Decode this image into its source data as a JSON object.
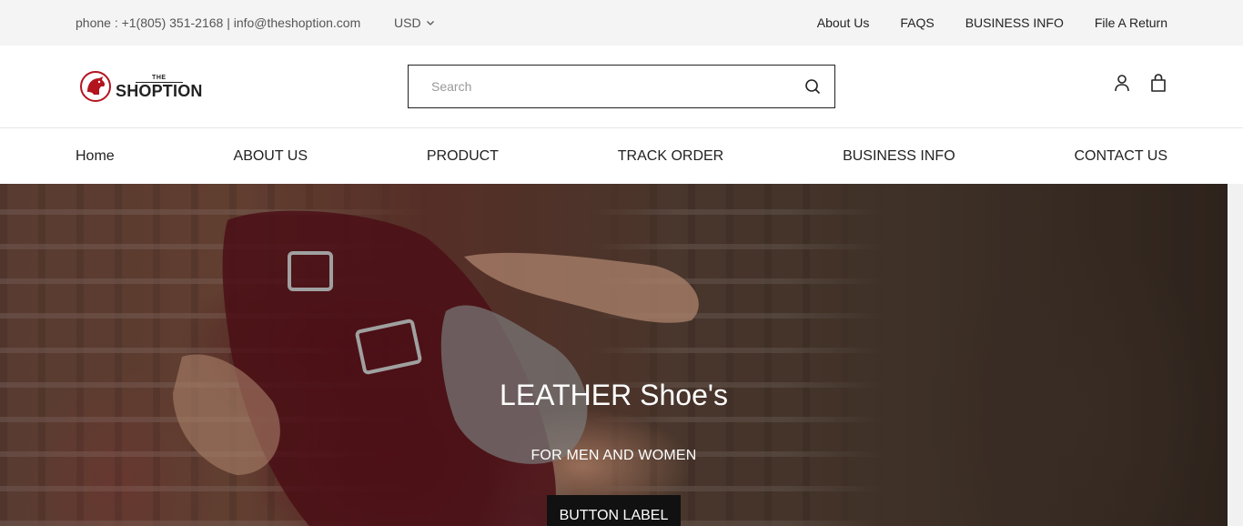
{
  "topbar": {
    "contact": "phone : +1(805) 351-2168 | info@theshoption.com",
    "currency": "USD",
    "links": [
      "About Us",
      "FAQS",
      "BUSINESS INFO",
      "File A Return"
    ]
  },
  "header": {
    "logo": {
      "small": "THE",
      "big": "SHOPTION"
    },
    "search_placeholder": "Search"
  },
  "nav": [
    "Home",
    "ABOUT US",
    "PRODUCT",
    "TRACK ORDER",
    "BUSINESS INFO",
    "CONTACT US"
  ],
  "hero": {
    "title": "LEATHER Shoe's",
    "subtitle": "FOR MEN AND WOMEN",
    "button": "BUTTON LABEL"
  },
  "colors": {
    "topbar_bg": "#f4f4f4",
    "logo_accent": "#b3141e",
    "button_bg": "#111111"
  }
}
